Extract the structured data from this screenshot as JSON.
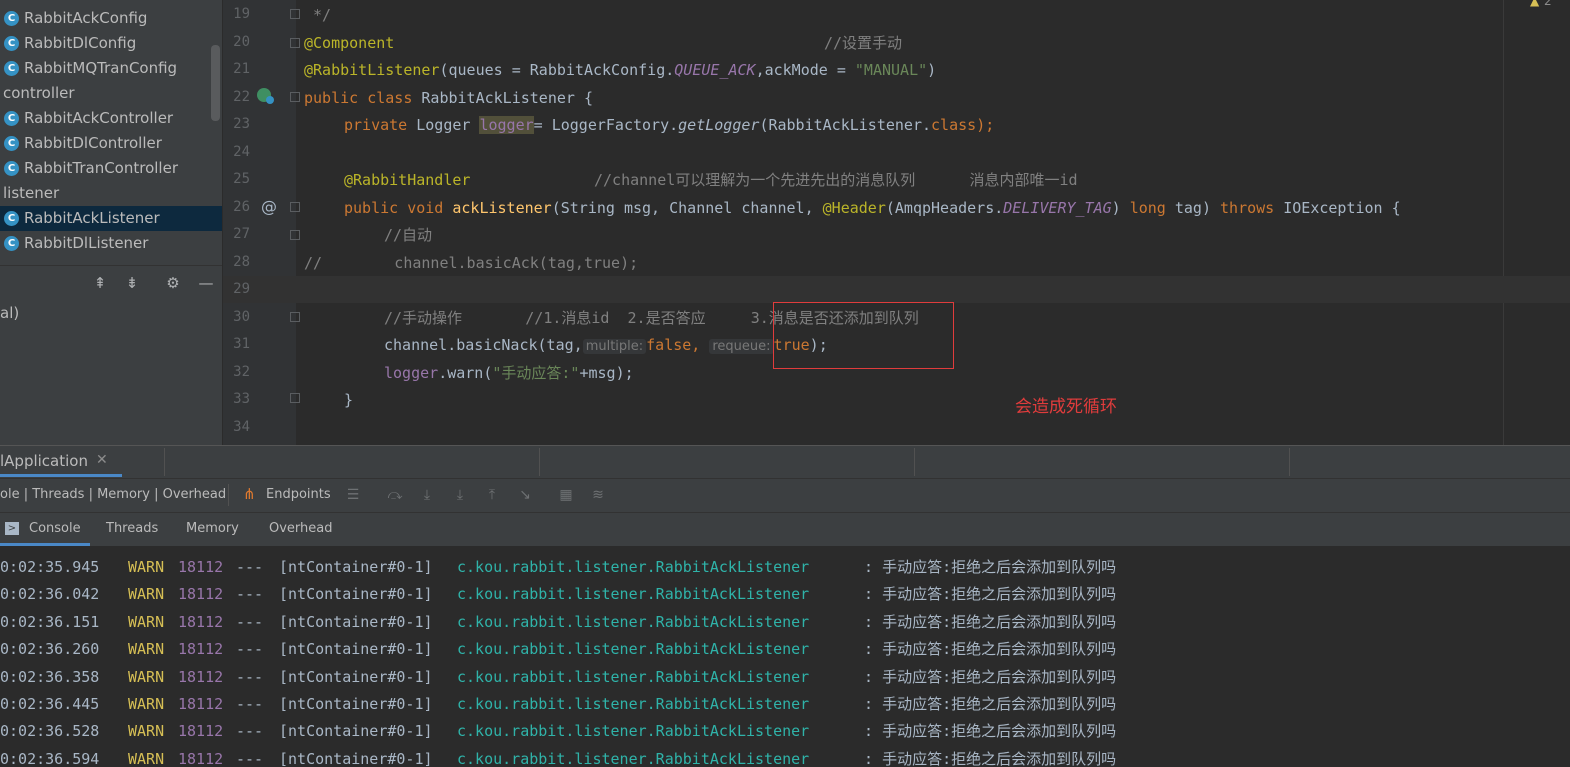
{
  "project_tree": {
    "items": [
      {
        "type": "class",
        "label": "RabbitAckConfig",
        "selected": false
      },
      {
        "type": "class",
        "label": "RabbitDlConfig",
        "selected": false
      },
      {
        "type": "class",
        "label": "RabbitMQTranConfig",
        "selected": false
      },
      {
        "type": "package",
        "label": "controller",
        "selected": false
      },
      {
        "type": "class",
        "label": "RabbitAckController",
        "selected": false
      },
      {
        "type": "class",
        "label": "RabbitDlController",
        "selected": false
      },
      {
        "type": "class",
        "label": "RabbitTranController",
        "selected": false
      },
      {
        "type": "package",
        "label": "listener",
        "selected": false
      },
      {
        "type": "class",
        "label": "RabbitAckListener",
        "selected": true
      },
      {
        "type": "class",
        "label": "RabbitDlListener",
        "selected": false
      }
    ],
    "class_icon_letter": "C",
    "toolbar_icons": [
      "expand-all-icon",
      "collapse-all-icon",
      "gear-icon",
      "minimize-icon"
    ]
  },
  "left_panel_text": "al)",
  "editor": {
    "line_numbers": [
      "19",
      "20",
      "21",
      "22",
      "23",
      "24",
      "25",
      "26",
      "27",
      "28",
      "29",
      "30",
      "31",
      "32",
      "33",
      "34"
    ],
    "current_line": "29",
    "lines": {
      "l19": " */",
      "l20_ann": "@Component",
      "l20_cm": "//设置手动",
      "l21_ann": "@RabbitListener",
      "l21_a": "(queues = RabbitAckConfig.",
      "l21_const": "QUEUE_ACK",
      "l21_b": ",ackMode = ",
      "l21_str": "\"MANUAL\"",
      "l21_c": ")",
      "l22_kw": "public class ",
      "l22_name": "RabbitAckListener {",
      "l23_kw": "private ",
      "l23_type": "Logger ",
      "l23_var": "logger",
      "l23_a": "= LoggerFactory.",
      "l23_fn": "getLogger",
      "l23_b": "(RabbitAckListener.",
      "l23_kw2": "class",
      "l23_c": ");",
      "l25_ann": "@RabbitHandler",
      "l25_cm": "//channel可以理解为一个先进先出的消息队列      消息内部唯一id",
      "l26_kw": "public void ",
      "l26_fn": "ackListener",
      "l26_a": "(String msg, Channel channel, ",
      "l26_ann": "@Header",
      "l26_b": "(AmqpHeaders.",
      "l26_const": "DELIVERY_TAG",
      "l26_c": ") ",
      "l26_kw2": "long ",
      "l26_d": "tag) ",
      "l26_kw3": "throws ",
      "l26_e": "IOException {",
      "l27_cm": "//自动",
      "l28_cm": "//        channel.basicAck(tag,true);",
      "l30_cm": "//手动操作       //1.消息id  2.是否答应     3.消息是否还添加到队列",
      "l31_a": "channel.basicNack(tag,",
      "l31_hint1": "multiple:",
      "l31_kw1": "false,",
      "l31_hint2": "requeue:",
      "l31_kw2": "true",
      "l31_b": ");",
      "l32_var": "logger",
      "l32_a": ".warn(",
      "l32_str": "\"手动应答:\"",
      "l32_b": "+msg);",
      "l33": "}"
    },
    "gutter_markers": {
      "l26": "@"
    },
    "annotation_note": "会造成死循环",
    "warning_badge": "2"
  },
  "bottom": {
    "run_tab": "lApplication",
    "actuator_tabs": "ole | Threads | Memory | Overhead",
    "endpoints": "Endpoints",
    "subtabs": [
      "Console",
      "Threads",
      "Memory",
      "Overhead"
    ],
    "log_lines": [
      {
        "time": "0:02:35.945",
        "level": "WARN",
        "pid": "18112",
        "sep": "---",
        "thread": "[ntContainer#0-1]",
        "logger": "c.kou.rabbit.listener.RabbitAckListener",
        "msg": "  : 手动应答:拒绝之后会添加到队列吗"
      },
      {
        "time": "0:02:36.042",
        "level": "WARN",
        "pid": "18112",
        "sep": "---",
        "thread": "[ntContainer#0-1]",
        "logger": "c.kou.rabbit.listener.RabbitAckListener",
        "msg": "  : 手动应答:拒绝之后会添加到队列吗"
      },
      {
        "time": "0:02:36.151",
        "level": "WARN",
        "pid": "18112",
        "sep": "---",
        "thread": "[ntContainer#0-1]",
        "logger": "c.kou.rabbit.listener.RabbitAckListener",
        "msg": "  : 手动应答:拒绝之后会添加到队列吗"
      },
      {
        "time": "0:02:36.260",
        "level": "WARN",
        "pid": "18112",
        "sep": "---",
        "thread": "[ntContainer#0-1]",
        "logger": "c.kou.rabbit.listener.RabbitAckListener",
        "msg": "  : 手动应答:拒绝之后会添加到队列吗"
      },
      {
        "time": "0:02:36.358",
        "level": "WARN",
        "pid": "18112",
        "sep": "---",
        "thread": "[ntContainer#0-1]",
        "logger": "c.kou.rabbit.listener.RabbitAckListener",
        "msg": "  : 手动应答:拒绝之后会添加到队列吗"
      },
      {
        "time": "0:02:36.445",
        "level": "WARN",
        "pid": "18112",
        "sep": "---",
        "thread": "[ntContainer#0-1]",
        "logger": "c.kou.rabbit.listener.RabbitAckListener",
        "msg": "  : 手动应答:拒绝之后会添加到队列吗"
      },
      {
        "time": "0:02:36.528",
        "level": "WARN",
        "pid": "18112",
        "sep": "---",
        "thread": "[ntContainer#0-1]",
        "logger": "c.kou.rabbit.listener.RabbitAckListener",
        "msg": "  : 手动应答:拒绝之后会添加到队列吗"
      },
      {
        "time": "0:02:36.594",
        "level": "WARN",
        "pid": "18112",
        "sep": "---",
        "thread": "[ntContainer#0-1]",
        "logger": "c.kou.rabbit.listener.RabbitAckListener",
        "msg": "  : 手动应答:拒绝之后会添加到队列吗"
      }
    ]
  }
}
